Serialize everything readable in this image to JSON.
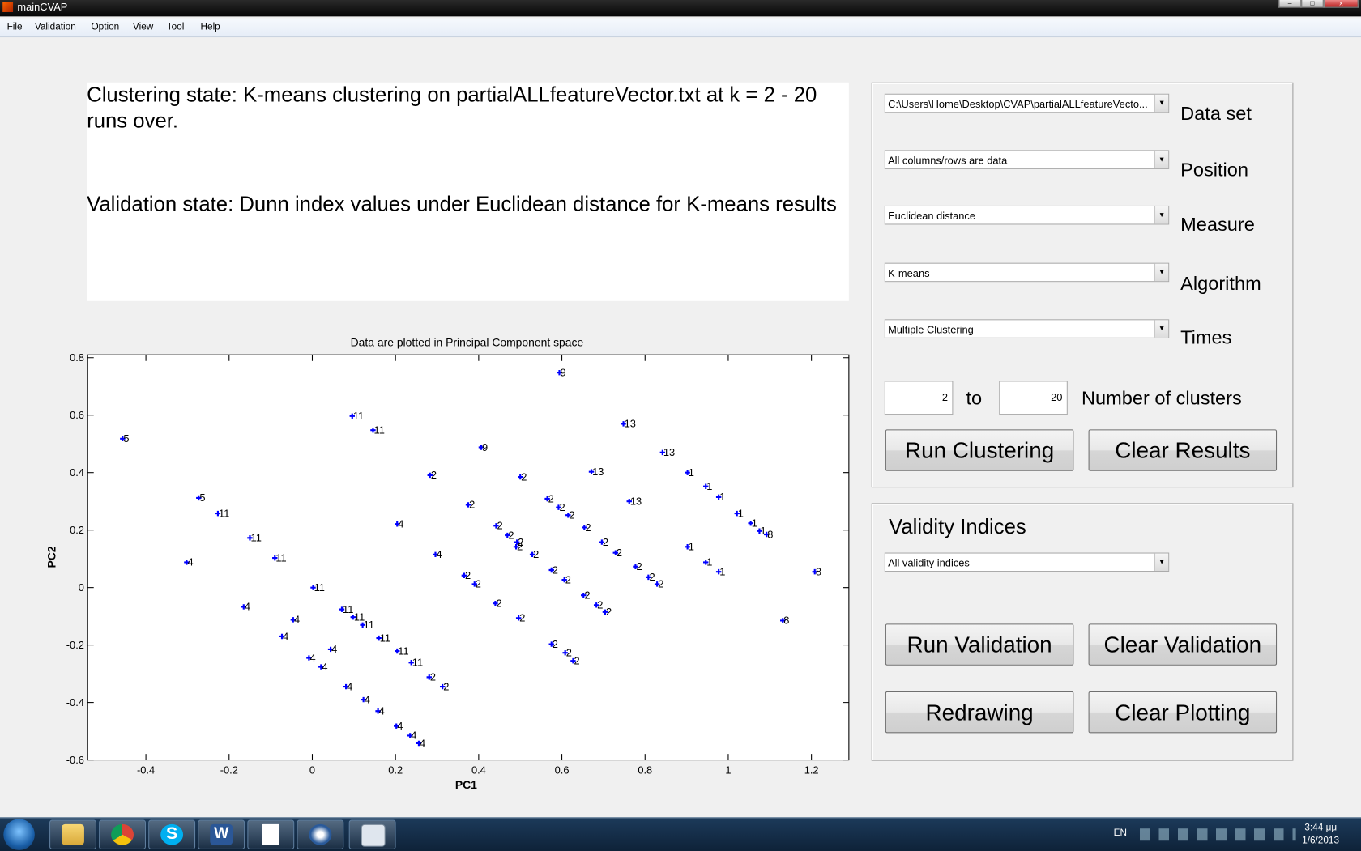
{
  "window": {
    "title": "mainCVAP",
    "controls": [
      "minimize",
      "maximize",
      "close"
    ]
  },
  "menu": [
    "File",
    "Validation",
    "Option",
    "View",
    "Tool",
    "Help"
  ],
  "status": {
    "clustering": "Clustering state: K-means clustering on  partialALLfeatureVector.txt at k = 2 - 20 runs over.",
    "validation": "Validation state: Dunn index values under Euclidean distance for K-means results"
  },
  "controls": {
    "dataset": {
      "value": "C:\\Users\\Home\\Desktop\\CVAP\\partialALLfeatureVecto...",
      "label": "Data set"
    },
    "position": {
      "value": "All columns/rows are data",
      "label": "Position"
    },
    "measure": {
      "value": "Euclidean distance",
      "label": "Measure"
    },
    "algorithm": {
      "value": "K-means",
      "label": "Algorithm"
    },
    "times": {
      "value": "Multiple Clustering",
      "label": "Times"
    },
    "k_from": "2",
    "to_label": "to",
    "k_to": "20",
    "clusters_label": "Number of clusters",
    "run_clustering": "Run Clustering",
    "clear_results": "Clear Results"
  },
  "validity": {
    "title": "Validity Indices",
    "select": "All validity indices",
    "run_validation": "Run Validation",
    "clear_validation": "Clear Validation",
    "redrawing": "Redrawing",
    "clear_plotting": "Clear Plotting"
  },
  "chart_data": {
    "type": "scatter",
    "title": "Data are plotted in Principal Component space",
    "xlabel": "PC1",
    "ylabel": "PC2",
    "xlim": [
      -0.54,
      1.29
    ],
    "ylim": [
      -0.6,
      0.81
    ],
    "xticks": [
      "-0.4",
      "-0.2",
      "0",
      "0.2",
      "0.4",
      "0.6",
      "0.8",
      "1",
      "1.2"
    ],
    "xtick_values": [
      -0.4,
      -0.2,
      0,
      0.2,
      0.4,
      0.6,
      0.8,
      1,
      1.2
    ],
    "yticks": [
      "0.8",
      "0.6",
      "0.4",
      "0.2",
      "0",
      "-0.2",
      "-0.4",
      "-0.6"
    ],
    "ytick_values": [
      0.8,
      0.6,
      0.4,
      0.2,
      0,
      -0.2,
      -0.4,
      -0.6
    ],
    "marker_color": "#0000ff",
    "grid": false,
    "points": [
      [
        -0.456,
        0.518,
        "5"
      ],
      [
        -0.273,
        0.312,
        "5"
      ],
      [
        -0.227,
        0.258,
        "11"
      ],
      [
        -0.15,
        0.173,
        "11"
      ],
      [
        -0.09,
        0.103,
        "11"
      ],
      [
        -0.302,
        0.088,
        "4"
      ],
      [
        0.002,
        0,
        "11"
      ],
      [
        -0.165,
        -0.067,
        "4"
      ],
      [
        -0.046,
        -0.112,
        "4"
      ],
      [
        -0.073,
        -0.17,
        "4"
      ],
      [
        0.071,
        -0.076,
        "11"
      ],
      [
        0.098,
        -0.103,
        "11"
      ],
      [
        0.121,
        -0.13,
        "11"
      ],
      [
        0.16,
        -0.176,
        "11"
      ],
      [
        0.204,
        -0.221,
        "11"
      ],
      [
        0.238,
        -0.261,
        "11"
      ],
      [
        0.044,
        -0.215,
        "4"
      ],
      [
        -0.008,
        -0.245,
        "4"
      ],
      [
        0.021,
        -0.276,
        "4"
      ],
      [
        0.081,
        -0.345,
        "4"
      ],
      [
        0.123,
        -0.39,
        "4"
      ],
      [
        0.158,
        -0.43,
        "4"
      ],
      [
        0.202,
        -0.482,
        "4"
      ],
      [
        0.235,
        -0.515,
        "4"
      ],
      [
        0.256,
        -0.542,
        "4"
      ],
      [
        0.281,
        -0.312,
        "2"
      ],
      [
        0.313,
        -0.345,
        "2"
      ],
      [
        0.096,
        0.597,
        "11"
      ],
      [
        0.146,
        0.548,
        "11"
      ],
      [
        0.283,
        0.391,
        "2"
      ],
      [
        0.204,
        0.221,
        "4"
      ],
      [
        0.296,
        0.115,
        "4"
      ],
      [
        0.375,
        0.288,
        "2"
      ],
      [
        0.365,
        0.042,
        "2"
      ],
      [
        0.39,
        0.012,
        "2"
      ],
      [
        0.406,
        0.488,
        "9"
      ],
      [
        0.594,
        0.748,
        "9"
      ],
      [
        0.5,
        0.385,
        "2"
      ],
      [
        0.442,
        0.215,
        "2"
      ],
      [
        0.469,
        0.182,
        "2"
      ],
      [
        0.492,
        0.158,
        "2"
      ],
      [
        0.49,
        0.142,
        "2"
      ],
      [
        0.529,
        0.115,
        "2"
      ],
      [
        0.44,
        -0.055,
        "2"
      ],
      [
        0.496,
        -0.106,
        "2"
      ],
      [
        0.565,
        0.309,
        "2"
      ],
      [
        0.592,
        0.279,
        "2"
      ],
      [
        0.615,
        0.252,
        "2"
      ],
      [
        0.654,
        0.209,
        "2"
      ],
      [
        0.575,
        0.061,
        "2"
      ],
      [
        0.606,
        0.027,
        "2"
      ],
      [
        0.575,
        -0.197,
        "2"
      ],
      [
        0.608,
        -0.227,
        "2"
      ],
      [
        0.627,
        -0.255,
        "2"
      ],
      [
        0.696,
        0.158,
        "2"
      ],
      [
        0.729,
        0.121,
        "2"
      ],
      [
        0.652,
        -0.027,
        "2"
      ],
      [
        0.683,
        -0.061,
        "2"
      ],
      [
        0.704,
        -0.085,
        "2"
      ],
      [
        0.777,
        0.073,
        "2"
      ],
      [
        0.808,
        0.036,
        "2"
      ],
      [
        0.829,
        0.012,
        "2"
      ],
      [
        0.671,
        0.403,
        "13"
      ],
      [
        0.748,
        0.57,
        "13"
      ],
      [
        0.842,
        0.47,
        "13"
      ],
      [
        0.762,
        0.3,
        "13"
      ],
      [
        0.902,
        0.4,
        "1"
      ],
      [
        0.946,
        0.352,
        "1"
      ],
      [
        0.977,
        0.315,
        "1"
      ],
      [
        1.021,
        0.258,
        "1"
      ],
      [
        1.054,
        0.224,
        "1"
      ],
      [
        1.075,
        0.197,
        "1"
      ],
      [
        1.092,
        0.185,
        "8"
      ],
      [
        0.902,
        0.142,
        "1"
      ],
      [
        0.946,
        0.088,
        "1"
      ],
      [
        0.977,
        0.055,
        "1"
      ],
      [
        1.208,
        0.055,
        "8"
      ],
      [
        1.131,
        -0.115,
        "8"
      ]
    ]
  },
  "taskbar": {
    "apps": [
      "start",
      "explorer",
      "chrome",
      "skype",
      "word",
      "blank-document",
      "matlab-bird",
      "cvap-window"
    ],
    "language": "EN",
    "time": "3:44 μμ",
    "date": "1/6/2013"
  }
}
